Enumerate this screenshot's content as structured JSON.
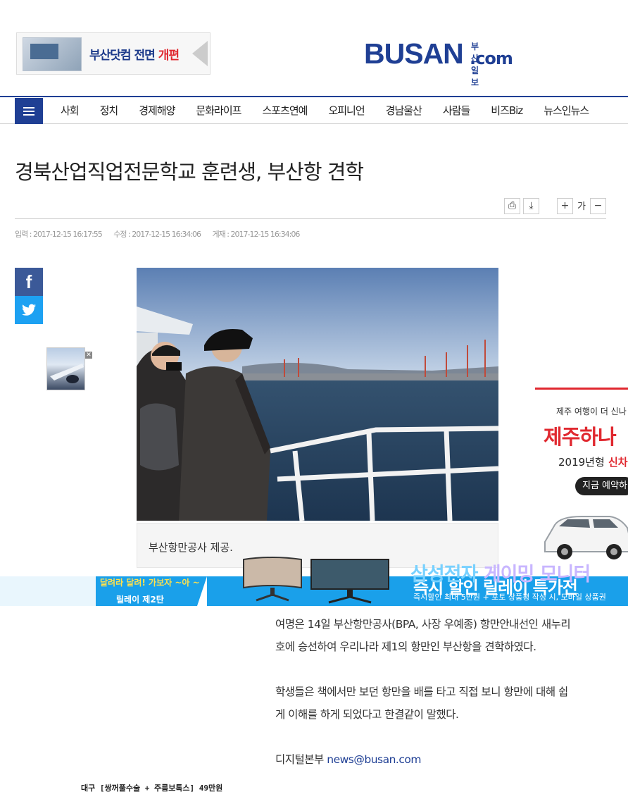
{
  "header": {
    "banner_text": "부산닷컴 전면",
    "banner_text_red": "개편",
    "logo_main": "BUSAN",
    "logo_small": "부산일보",
    "logo_com": ".com"
  },
  "nav": {
    "items": [
      "사회",
      "정치",
      "경제해양",
      "문화라이프",
      "스포츠연예",
      "오피니언",
      "경남울산",
      "사람들",
      "비즈Biz",
      "뉴스인뉴스"
    ]
  },
  "article": {
    "title": "경북산업직업전문학교 훈련생, 부산항 견학",
    "tools": {
      "print": "⎙",
      "download": "⤓",
      "font_up": "+",
      "font_label": "가",
      "font_down": "−"
    },
    "dates": {
      "input": "입력 : 2017-12-15 16:17:55",
      "modified": "수정 : 2017-12-15 16:34:06",
      "published": "게재 : 2017-12-15 16:34:06"
    },
    "caption": "부산항만공사 제공.",
    "paragraphs": [
      "여명은 14일 부산항만공사(BPA, 사장 우예종) 항만안내선인 새누리호에 승선하여 우리나라 제1의 항만인 부산항을 견학하였다.",
      "학생들은 책에서만 보던 항만을 배를 타고 직접 보니 항만에 대해 쉽게 이해를 하게 되었다고 한결같이 말했다."
    ],
    "byline": "디지털본부",
    "email": "news@busan.com"
  },
  "social": {
    "facebook": "f"
  },
  "ads": {
    "right": {
      "line1": "제주 여행이 더 신나",
      "line2": "제주하나",
      "line3_pre": "2019년형",
      "line3_red": " 신차",
      "cta": "지금 예약하"
    },
    "bottom": {
      "tag1": "달려라 달려! 가보자 ~아 ~",
      "tag2": "릴레이 제2탄",
      "samsung_a": "삼성전자",
      "samsung_b": " 게이밍 모니터",
      "main": "즉시 할인 릴레이 특가전",
      "sub": "즉시할인 최대 5만원 + 포토 상품평 작성 시, 모바일 상품권"
    },
    "text_ad": "대구 [쌍꺼풀수술 + 주름보톡스] 49만원",
    "close": "✕"
  },
  "colors": {
    "brand": "#1f3f94",
    "accent_red": "#e0282f",
    "facebook": "#3b5998",
    "twitter": "#1da1f2"
  }
}
